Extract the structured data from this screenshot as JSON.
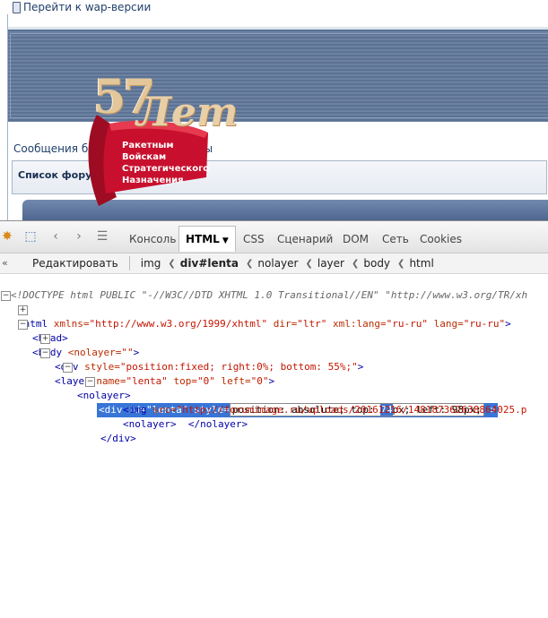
{
  "page": {
    "wap_link": "Перейти к wap-версии",
    "messages_line_left": "Сообщения бе",
    "messages_line_right": "мы",
    "forum_list": "Список форумов"
  },
  "banner": {
    "number": "57",
    "word": "Лет",
    "lines": [
      "Ракетным",
      "Войскам",
      "Стратегического",
      "Назначения"
    ],
    "ribbon_color": "#c8102e"
  },
  "firebug": {
    "tabs": [
      "Консоль",
      "HTML",
      "CSS",
      "Сценарий",
      "DOM",
      "Сеть",
      "Cookies"
    ],
    "active_tab": "HTML",
    "edit_label": "Редактировать",
    "breadcrumbs": [
      "img",
      "div#lenta",
      "nolayer",
      "layer",
      "body",
      "html"
    ],
    "current_crumb": "div#lenta",
    "tree": {
      "doctype": "<!DOCTYPE html PUBLIC \"-//W3C//DTD XHTML 1.0 Transitional//EN\" \"http://www.w3.org/TR/xh",
      "html_open_tag": "<html",
      "html_xmlns_attr": " xmlns=",
      "html_xmlns_val": "\"http://www.w3.org/1999/xhtml\"",
      "html_dir_attr": " dir=",
      "html_dir_val": "\"ltr\"",
      "html_lang_attr": " xml:lang=",
      "html_lang_val": "\"ru-ru\"",
      "html_lang2_attr": " lang=",
      "html_lang2_val": "\"ru-ru\"",
      "html_close": ">",
      "head": "<head>",
      "body_open": "<body",
      "body_attr": " <nolayer=",
      "body_val": "\"\"",
      "body_close": ">",
      "div_open": "<div",
      "div_attr": " style=",
      "div_val": "\"position:fixed; right:0%; bottom: 55%;\"",
      "div_close": ">",
      "layer_open": "<layer",
      "layer_name_attr": " name=",
      "layer_name_val": "\"lenta\"",
      "layer_top_attr": " top=",
      "layer_top_val": "\"0\"",
      "layer_left_attr": " left=",
      "layer_left_val": "\"0\"",
      "layer_close": ">",
      "nolayer_open": "<nolayer>",
      "sel_open": "<div",
      "sel_id_attr": " id=",
      "sel_id_val": "\"lenta\"",
      "sel_style_attr": " style=",
      "edit_before": "position: absolute; top: ",
      "edit_highlight": "74",
      "edit_after": "px; left: 98px;",
      "sel_end": " >",
      "img_open": "<img",
      "img_src_attr": " src=",
      "img_src_val": "\"http://forumimage.ru/uploads/20161216/148187362638864025.p",
      "nolayer_pair_open": "<nolayer>",
      "nolayer_pair_close": "</nolayer>",
      "div_close_tag": "</div>"
    }
  }
}
